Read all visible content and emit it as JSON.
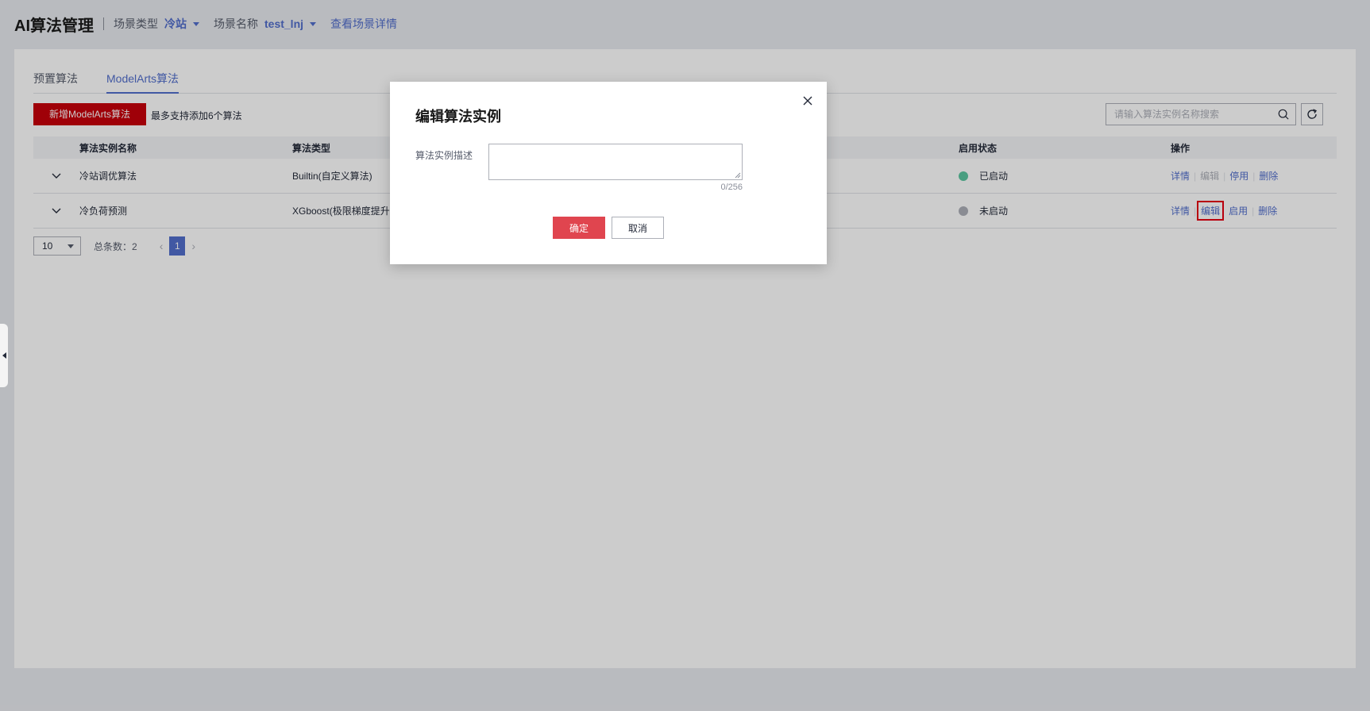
{
  "header": {
    "app_title": "AI算法管理",
    "scene_type_label": "场景类型",
    "scene_type_value": "冷站",
    "scene_name_label": "场景名称",
    "scene_name_value": "test_lnj",
    "scene_detail_link": "查看场景详情"
  },
  "tabs": [
    {
      "label": "预置算法",
      "active": false
    },
    {
      "label": "ModelArts算法",
      "active": true
    }
  ],
  "toolbar": {
    "add_button": "新增ModelArts算法",
    "hint": "最多支持添加6个算法",
    "search_placeholder": "请输入算法实例名称搜索"
  },
  "table": {
    "columns": {
      "name": "算法实例名称",
      "type": "算法类型",
      "status": "启用状态",
      "ops": "操作"
    },
    "rows": [
      {
        "name": "冷站调优算法",
        "type": "Builtin(自定义算法)",
        "status": "已启动",
        "status_color": "#5cc6a0",
        "ops": {
          "detail": "详情",
          "edit": "编辑",
          "toggle": "停用",
          "delete": "删除"
        }
      },
      {
        "name": "冷负荷预测",
        "type": "XGboost(极限梯度提升算法)",
        "status": "未启动",
        "status_color": "#adb0b8",
        "ops": {
          "detail": "详情",
          "edit": "编辑",
          "toggle": "启用",
          "delete": "删除"
        }
      }
    ]
  },
  "pager": {
    "page_size": "10",
    "total": "总条数：2",
    "current_page": "1"
  },
  "dialog": {
    "title": "编辑算法实例",
    "field_label": "算法实例描述",
    "field_value": "",
    "char_count": "0/256",
    "ok_button": "确定",
    "cancel_button": "取消"
  },
  "colors": {
    "brand_red": "#c7000b",
    "link_blue": "#526ecc",
    "confirm_red": "#e0454f"
  }
}
